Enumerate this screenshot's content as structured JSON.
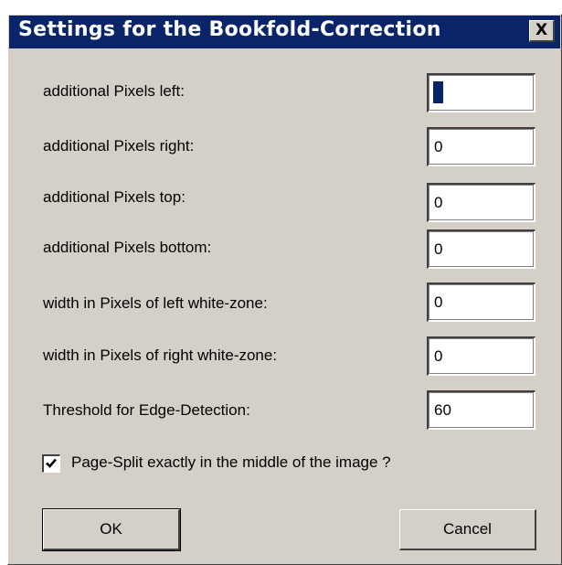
{
  "window": {
    "title": "Settings for the Bookfold-Correction",
    "close_label": "X"
  },
  "fields": [
    {
      "label": "additional Pixels left:",
      "value": "0"
    },
    {
      "label": "additional Pixels right:",
      "value": "0"
    },
    {
      "label": "additional Pixels top:",
      "value": "0"
    },
    {
      "label": "additional Pixels bottom:",
      "value": "0"
    },
    {
      "label": "width in Pixels of left white-zone:",
      "value": "0"
    },
    {
      "label": "width in Pixels of right white-zone:",
      "value": "0"
    },
    {
      "label": "Threshold for Edge-Detection:",
      "value": "60"
    }
  ],
  "checkbox": {
    "label": "Page-Split exactly in the middle of the image ?",
    "checked": true
  },
  "buttons": {
    "ok_label": "OK",
    "cancel_label": "Cancel"
  },
  "colors": {
    "titlebar": "#0a246a",
    "dialog_bg": "#d4d0c8"
  }
}
